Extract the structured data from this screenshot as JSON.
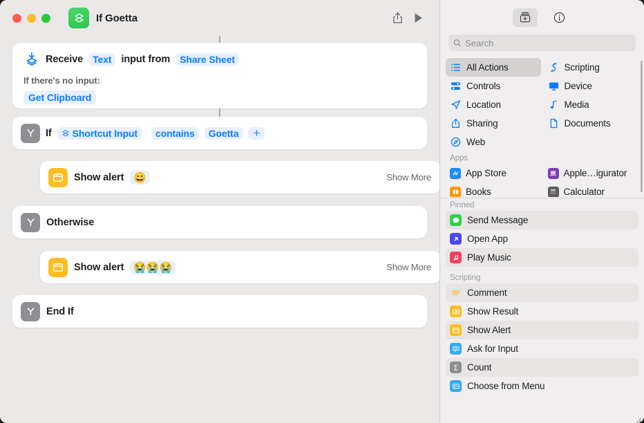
{
  "window": {
    "title": "If Goetta",
    "app_icon": "shortcuts-icon",
    "traffic_lights": [
      "close",
      "minimize",
      "zoom"
    ],
    "toolbar": {
      "share_label": "share-icon",
      "run_label": "play-icon"
    }
  },
  "editor": {
    "actions": [
      {
        "id": "receive-input",
        "icon": "receive-input-icon",
        "prefix": "Receive",
        "type_chip": "Text",
        "middle": "input from",
        "source_chip": "Share Sheet",
        "no_input_label": "If there's no input:",
        "fallback_chip": "Get Clipboard"
      },
      {
        "id": "if",
        "icon": "branch-icon",
        "label": "If",
        "variable_chip": "Shortcut Input",
        "operator_chip": "contains",
        "value_chip": "Goetta",
        "add_chip": "+"
      },
      {
        "id": "show-alert-1",
        "icon": "alert-icon",
        "label": "Show alert",
        "value_chip": "😀",
        "show_more": "Show More"
      },
      {
        "id": "otherwise",
        "icon": "branch-icon",
        "label": "Otherwise"
      },
      {
        "id": "show-alert-2",
        "icon": "alert-icon",
        "label": "Show alert",
        "value_chip": "😭😭😭",
        "show_more": "Show More"
      },
      {
        "id": "end-if",
        "icon": "branch-icon",
        "label": "End If"
      }
    ]
  },
  "sidebar": {
    "toolbar": {
      "library_icon": "action-library-icon",
      "info_icon": "info-circle-icon"
    },
    "search": {
      "placeholder": "Search",
      "value": "",
      "icon": "search-icon"
    },
    "categories": [
      {
        "label": "All Actions",
        "icon": "list-icon",
        "selected": true
      },
      {
        "label": "Scripting",
        "icon": "scripting-icon",
        "selected": false
      },
      {
        "label": "Controls",
        "icon": "controls-icon",
        "selected": false
      },
      {
        "label": "Device",
        "icon": "display-icon",
        "selected": false
      },
      {
        "label": "Location",
        "icon": "location-arrow-icon",
        "selected": false
      },
      {
        "label": "Media",
        "icon": "music-note-icon",
        "selected": false
      },
      {
        "label": "Sharing",
        "icon": "share-icon",
        "selected": false
      },
      {
        "label": "Documents",
        "icon": "document-icon",
        "selected": false
      },
      {
        "label": "Web",
        "icon": "safari-compass-icon",
        "selected": false
      }
    ],
    "apps_section": {
      "header": "Apps",
      "items": [
        {
          "label": "App Store",
          "icon": "app-store-icon",
          "color": "#1d8bf8"
        },
        {
          "label": "Apple…igurator",
          "icon": "apple-configurator-icon",
          "color": "#7b3fb5"
        },
        {
          "label": "Books",
          "icon": "books-icon",
          "color": "#ff9500"
        },
        {
          "label": "Calculator",
          "icon": "calculator-icon",
          "color": "#5a5a5f"
        }
      ]
    },
    "pinned_section": {
      "header": "Pinned",
      "items": [
        {
          "label": "Send Message",
          "icon": "messages-icon",
          "color": "#2fd14f",
          "alt": true
        },
        {
          "label": "Open App",
          "icon": "open-app-icon",
          "color": "#4a4ae8",
          "alt": false
        },
        {
          "label": "Play Music",
          "icon": "music-icon",
          "color": "#f4405a",
          "alt": true
        }
      ]
    },
    "scripting_section": {
      "header": "Scripting",
      "items": [
        {
          "label": "Comment",
          "icon": "comment-icon",
          "color": "#ffffff",
          "alt": true
        },
        {
          "label": "Show Result",
          "icon": "show-result-icon",
          "color": "#fdbd23",
          "alt": false
        },
        {
          "label": "Show Alert",
          "icon": "show-alert-icon",
          "color": "#fdbd23",
          "alt": true
        },
        {
          "label": "Ask for Input",
          "icon": "ask-for-input-icon",
          "color": "#34aaf5",
          "alt": false
        },
        {
          "label": "Count",
          "icon": "count-icon",
          "color": "#8e8e93",
          "alt": true
        },
        {
          "label": "Choose from Menu",
          "icon": "choose-from-menu-icon",
          "color": "#34aaf5",
          "alt": false
        }
      ]
    }
  },
  "colors": {
    "accent_blue": "#0a7cff",
    "chip_bg": "#e8f0fe",
    "canvas_bg": "#ebe8e8",
    "sidebar_bg": "#f0eeee",
    "card_bg": "#ffffff"
  }
}
